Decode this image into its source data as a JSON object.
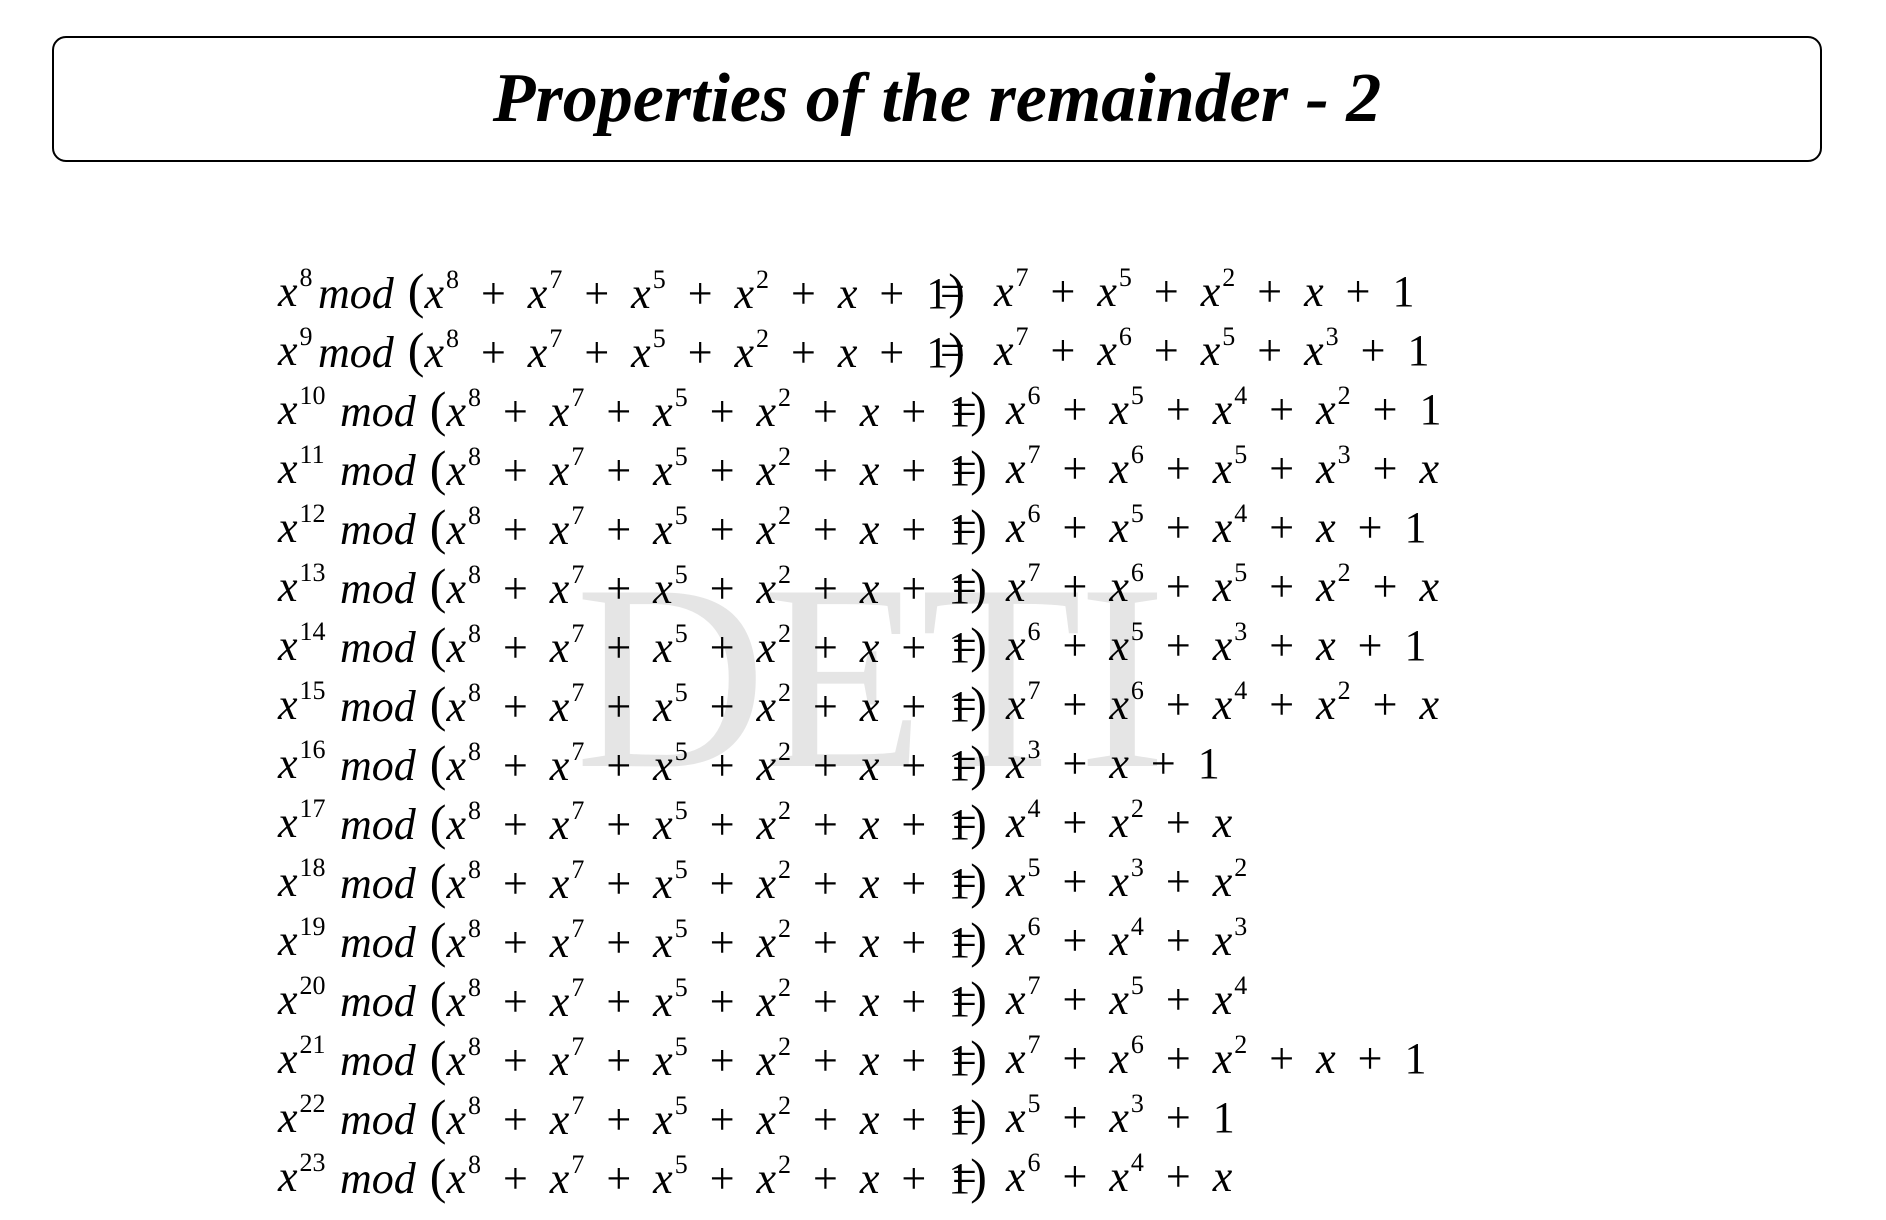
{
  "title": "Properties of the remainder - 2",
  "watermark": "DETI",
  "divisor": "(x^8 + x^7 + x^5 + x^2 + x + 1)",
  "mod_label": "mod",
  "equals_sign": "=",
  "rows": [
    {
      "power": "8",
      "remainder": "x^7 + x^5 + x^2 + x + 1"
    },
    {
      "power": "9",
      "remainder": "x^7 + x^6 + x^5 + x^3 + 1"
    },
    {
      "power": "10",
      "remainder": "x^6 + x^5 + x^4 + x^2 + 1"
    },
    {
      "power": "11",
      "remainder": "x^7 + x^6 + x^5 + x^3 + x"
    },
    {
      "power": "12",
      "remainder": "x^6 + x^5 + x^4 + x + 1"
    },
    {
      "power": "13",
      "remainder": "x^7 + x^6 + x^5 + x^2 + x"
    },
    {
      "power": "14",
      "remainder": "x^6 + x^5 + x^3 + x + 1"
    },
    {
      "power": "15",
      "remainder": "x^7 + x^6 + x^4 + x^2 + x"
    },
    {
      "power": "16",
      "remainder": "x^3 + x + 1"
    },
    {
      "power": "17",
      "remainder": "x^4 + x^2 + x"
    },
    {
      "power": "18",
      "remainder": "x^5 + x^3 + x^2"
    },
    {
      "power": "19",
      "remainder": "x^6 + x^4 + x^3"
    },
    {
      "power": "20",
      "remainder": "x^7 + x^5 + x^4"
    },
    {
      "power": "21",
      "remainder": "x^7 + x^6 + x^2 + x + 1"
    },
    {
      "power": "22",
      "remainder": "x^5 + x^3 + 1"
    },
    {
      "power": "23",
      "remainder": "x^6 + x^4 + x"
    }
  ]
}
